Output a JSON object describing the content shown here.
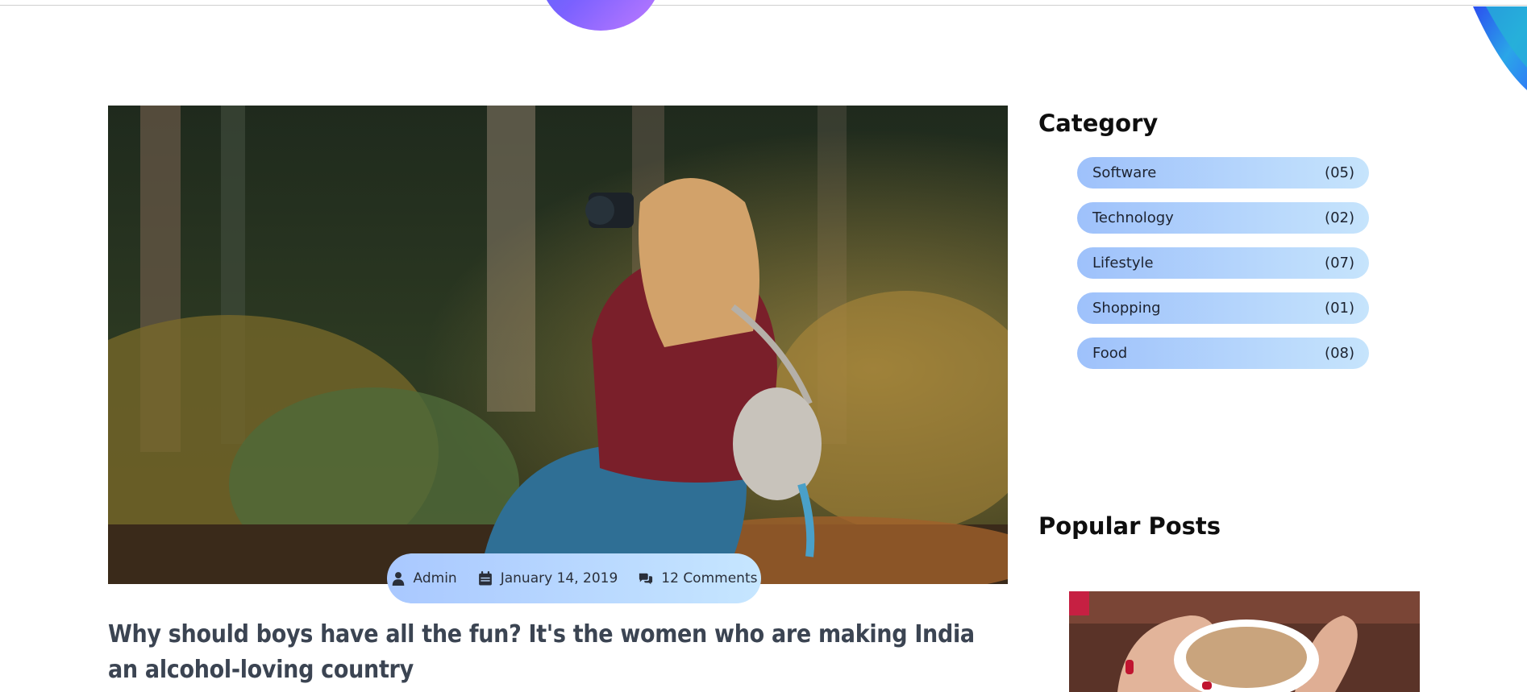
{
  "post": {
    "author": "Admin",
    "date": "January 14, 2019",
    "comments": "12 Comments",
    "title": "Why should boys have all the fun? It's the women who are making India an alcohol-loving country"
  },
  "sidebar": {
    "category_title": "Category",
    "categories": [
      {
        "label": "Software",
        "count": "(05)"
      },
      {
        "label": "Technology",
        "count": "(02)"
      },
      {
        "label": "Lifestyle",
        "count": "(07)"
      },
      {
        "label": "Shopping",
        "count": "(01)"
      },
      {
        "label": "Food",
        "count": "(08)"
      }
    ],
    "popular_title": "Popular Posts"
  },
  "icons": {
    "author": "user-icon",
    "date": "calendar-icon",
    "comments": "comments-icon"
  },
  "colors": {
    "pill_start": "#a9c8ff",
    "pill_end": "#c6e6ff",
    "title": "#3b4452",
    "accent": "#4a6cf7"
  }
}
